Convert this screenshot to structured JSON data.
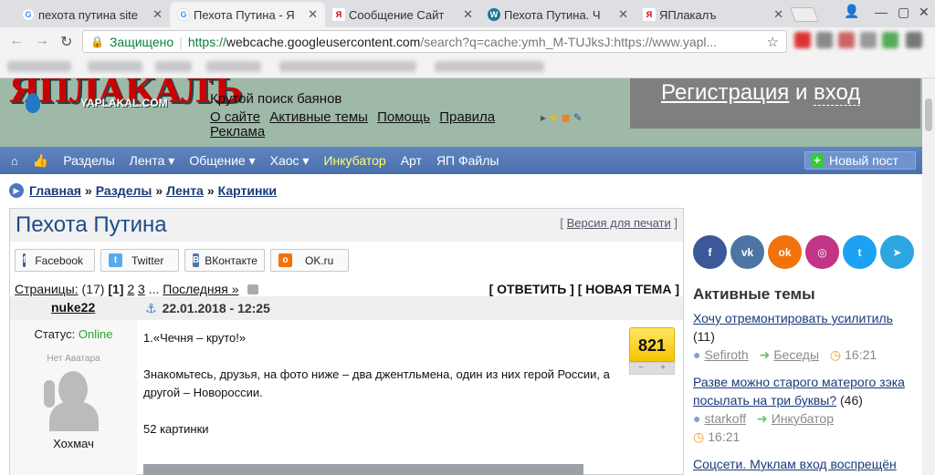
{
  "browser": {
    "tabs": [
      {
        "title": "пехота путина site",
        "favicon": "google-icon",
        "active": false
      },
      {
        "title": "Пехота Путина - Я",
        "favicon": "google-icon",
        "active": true
      },
      {
        "title": "Сообщение Сайт",
        "favicon": "yaplakal-icon",
        "active": false
      },
      {
        "title": "Пехота Путина. Ч",
        "favicon": "wordpress-icon",
        "active": false
      },
      {
        "title": "ЯПлакалъ",
        "favicon": "yaplakal-icon",
        "active": false
      }
    ],
    "secure_label": "Защищено",
    "url_scheme": "https://",
    "url_host": "webcache.googleusercontent.com",
    "url_rest": "/search?q=cache:ymh_M-TUJksJ:https://www.yapl..."
  },
  "header": {
    "logo_main": "ЯПЛАКАЛЪ",
    "logo_domain": "YAPLAKAL.COM",
    "tagline": "Крутой поиск баянов",
    "links": [
      "О сайте",
      "Активные темы",
      "Помощь",
      "Правила",
      "Реклама"
    ],
    "register": "Регистрация",
    "and": "и",
    "login": "вход"
  },
  "menu": {
    "items": [
      "Разделы",
      "Лента ▾",
      "Общение ▾",
      "Хаос ▾",
      "Инкубатор",
      "Арт",
      "ЯП Файлы"
    ],
    "highlight_color": "#ffff66",
    "new_post": "Новый пост"
  },
  "breadcrumbs": [
    "Главная",
    "Разделы",
    "Лента",
    "Картинки"
  ],
  "topic": {
    "title": "Пехота Путина",
    "print_link": "Версия для печати",
    "share": [
      "Facebook",
      "Twitter",
      "ВКонтакте",
      "OK.ru"
    ],
    "pages_label": "Страницы:",
    "pages_count": "(17)",
    "current_page": "[1]",
    "page_links": [
      "2",
      "3"
    ],
    "ellipsis": "...",
    "last": "Последняя »",
    "reply": "ОТВЕТИТЬ",
    "new_topic": "НОВАЯ ТЕМА"
  },
  "post": {
    "author": "nuke22",
    "date": "22.01.2018 - 12:25",
    "status_label": "Статус:",
    "status_value": "Online",
    "no_avatar": "Нет Аватара",
    "nick": "Хохмач",
    "rating": "821",
    "rating_minus": "−",
    "rating_plus": "+",
    "lines": [
      "1.«Чечня – круто!»",
      "Знакомьтесь, друзья, на фото ниже – два джентльмена, один из них герой России, а другой – Новороссии.",
      "52 картинки"
    ]
  },
  "sidebar": {
    "socials": [
      "facebook",
      "vkontakte",
      "odnoklassniki",
      "instagram",
      "twitter",
      "telegram"
    ],
    "title": "Активные темы",
    "items": [
      {
        "title": "Хочу отремонтировать усилитиль",
        "count": "(11)",
        "user": "Sefiroth",
        "section": "Беседы",
        "time": "16:21"
      },
      {
        "title": "Разве можно старого матерого зэка посылать на три буквы?",
        "count": "(46)",
        "user": "starkoff",
        "section": "Инкубатор",
        "time": "16:21"
      },
      {
        "title": "Соцсети. Муклам вход воспрещён"
      }
    ]
  }
}
